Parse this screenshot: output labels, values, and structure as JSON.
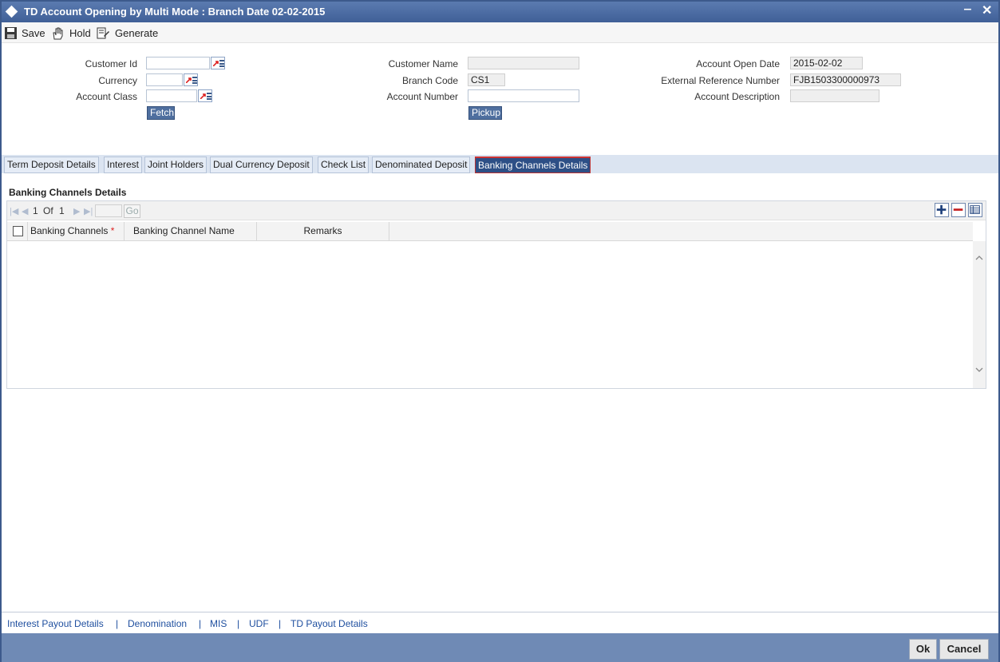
{
  "window": {
    "title": "TD Account Opening by Multi Mode : Branch Date 02-02-2015",
    "minimize_glyph": "‒",
    "close_glyph": "✕"
  },
  "toolbar": {
    "save_label": "Save",
    "hold_label": "Hold",
    "generate_label": "Generate"
  },
  "form": {
    "customer_id_label": "Customer Id",
    "customer_id_value": "",
    "currency_label": "Currency",
    "currency_value": "",
    "account_class_label": "Account Class",
    "account_class_value": "",
    "fetch_label": "Fetch",
    "customer_name_label": "Customer Name",
    "customer_name_value": "",
    "branch_code_label": "Branch Code",
    "branch_code_value": "CS1",
    "account_number_label": "Account Number",
    "account_number_value": "",
    "pickup_label": "Pickup",
    "account_open_date_label": "Account Open Date",
    "account_open_date_value": "2015-02-02",
    "ext_ref_label": "External Reference Number",
    "ext_ref_value": "FJB1503300000973",
    "account_desc_label": "Account Description",
    "account_desc_value": ""
  },
  "tabs": [
    {
      "label": "Term Deposit Details"
    },
    {
      "label": "Interest"
    },
    {
      "label": "Joint Holders"
    },
    {
      "label": "Dual Currency Deposit"
    },
    {
      "label": "Check List"
    },
    {
      "label": "Denominated Deposit"
    },
    {
      "label": "Banking Channels Details",
      "active": true
    }
  ],
  "section": {
    "title": "Banking Channels Details",
    "pager": {
      "current": "1",
      "of_label": "Of",
      "total": "1",
      "go_label": "Go"
    },
    "columns": {
      "banking_channels": "Banking Channels",
      "required_mark": "*",
      "banking_channel_name": "Banking Channel Name",
      "remarks": "Remarks"
    },
    "rows": []
  },
  "bottom_links": {
    "interest_payout": "Interest Payout Details",
    "denomination": "Denomination",
    "mis": "MIS",
    "udf": "UDF",
    "td_payout": "TD Payout Details",
    "separator": "|"
  },
  "footer": {
    "ok_label": "Ok",
    "cancel_label": "Cancel"
  },
  "colors": {
    "title_bar": "#3f5f97",
    "active_tab": "#2d4f86",
    "footer": "#6f8ab5",
    "link": "#1f4f9f"
  }
}
